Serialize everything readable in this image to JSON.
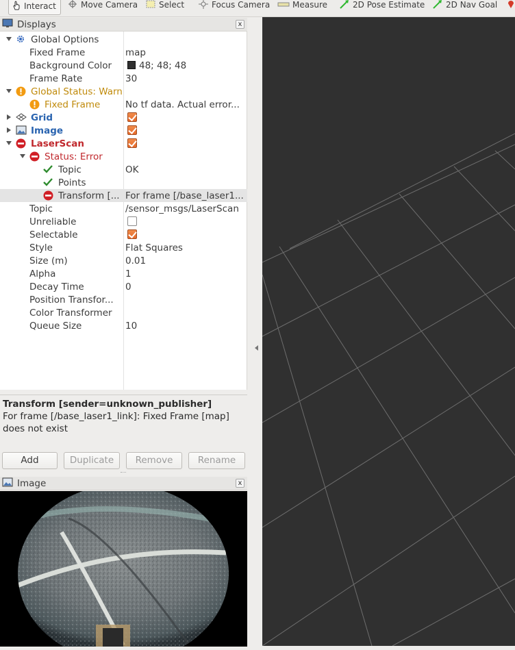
{
  "toolbar": {
    "items": [
      "Interact",
      "Move Camera",
      "Select",
      "Focus Camera",
      "Measure",
      "2D Pose Estimate",
      "2D Nav Goal"
    ]
  },
  "displays_panel": {
    "title": "Displays",
    "close": "x",
    "rows": [
      {
        "label": "Global Options",
        "value": ""
      },
      {
        "label": "Fixed Frame",
        "value": "map"
      },
      {
        "label": "Background Color",
        "value": "48; 48; 48"
      },
      {
        "label": "Frame Rate",
        "value": "30"
      },
      {
        "label": "Global Status: Warn",
        "value": ""
      },
      {
        "label": "Fixed Frame",
        "value": "No tf data.  Actual error..."
      },
      {
        "label": "Grid",
        "value": ""
      },
      {
        "label": "Image",
        "value": ""
      },
      {
        "label": "LaserScan",
        "value": ""
      },
      {
        "label": "Status: Error",
        "value": ""
      },
      {
        "label": "Topic",
        "value": "OK"
      },
      {
        "label": "Points",
        "value": ""
      },
      {
        "label": "Transform [...",
        "value": "For frame [/base_laser1..."
      },
      {
        "label": "Topic",
        "value": "/sensor_msgs/LaserScan"
      },
      {
        "label": "Unreliable",
        "value": ""
      },
      {
        "label": "Selectable",
        "value": ""
      },
      {
        "label": "Style",
        "value": "Flat Squares"
      },
      {
        "label": "Size (m)",
        "value": "0.01"
      },
      {
        "label": "Alpha",
        "value": "1"
      },
      {
        "label": "Decay Time",
        "value": "0"
      },
      {
        "label": "Position Transfor...",
        "value": ""
      },
      {
        "label": "Color Transformer",
        "value": ""
      },
      {
        "label": "Queue Size",
        "value": "10"
      }
    ],
    "checkboxes": {
      "grid": true,
      "image": true,
      "laserscan": true,
      "unreliable": false,
      "selectable": true
    },
    "background_swatch": "#303030"
  },
  "description": {
    "heading": "Transform [sender=unknown_publisher]",
    "body": "For frame [/base_laser1_link]: Fixed Frame [map] does not exist"
  },
  "buttons": {
    "add": "Add",
    "duplicate": "Duplicate",
    "remove": "Remove",
    "rename": "Rename"
  },
  "image_panel": {
    "title": "Image",
    "close": "x"
  },
  "colors": {
    "viewport_bg": "#303030",
    "grid_line": "#a0a0a0",
    "checkbox": "#e8743b",
    "warn": "#c08a0a",
    "error": "#c0282d",
    "link_blue": "#2a64b0"
  }
}
